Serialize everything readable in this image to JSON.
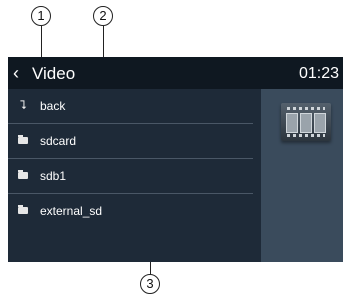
{
  "callouts": {
    "c1": "1",
    "c2": "2",
    "c3": "3"
  },
  "header": {
    "back_glyph": "‹",
    "title": "Video",
    "time": "01:23"
  },
  "list": {
    "items": [
      {
        "icon": "return-arrow-icon",
        "label": "back"
      },
      {
        "icon": "folder-icon",
        "label": "sdcard"
      },
      {
        "icon": "folder-icon",
        "label": "sdb1"
      },
      {
        "icon": "folder-icon",
        "label": "external_sd"
      }
    ]
  },
  "side_panel": {
    "icon": "video-film-icon"
  },
  "colors": {
    "screen_bg": "#1e2a38",
    "topbar_bg": "#0f1821",
    "divider": "#4a5766",
    "side_panel_bg": "#3a4b5c"
  }
}
